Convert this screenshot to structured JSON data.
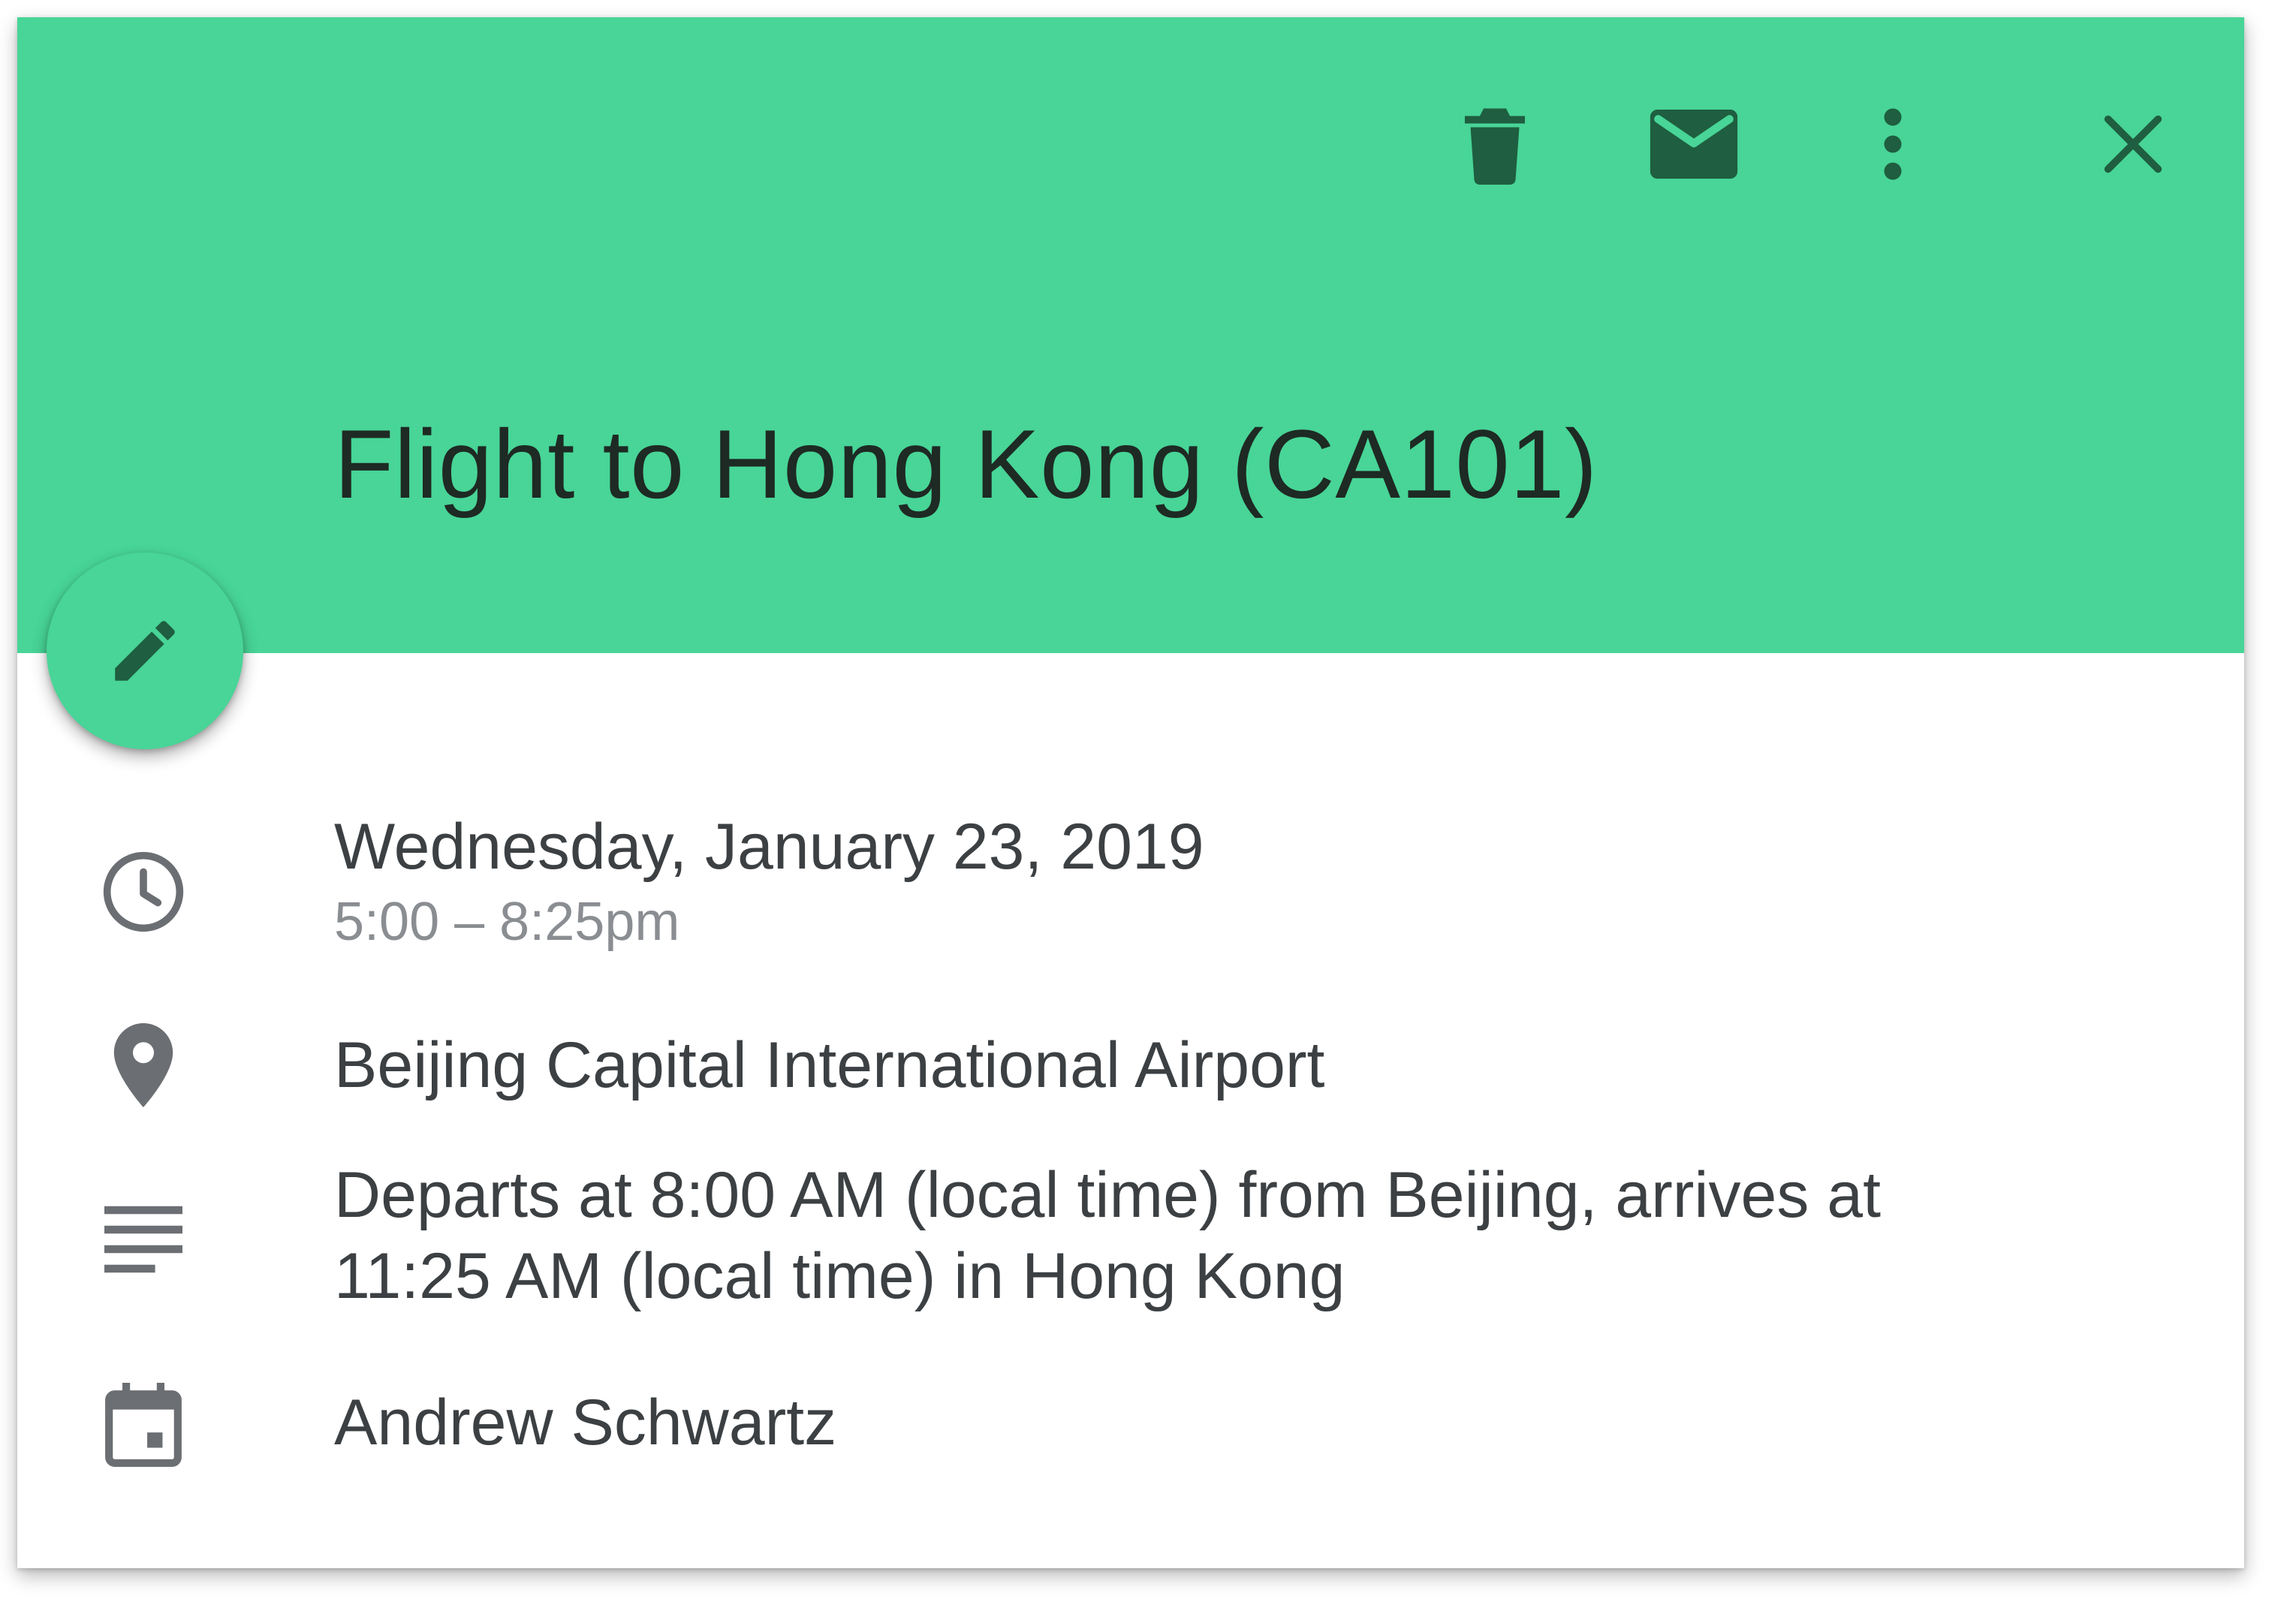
{
  "colors": {
    "header_bg": "#48d597",
    "header_icon": "#1f5e40",
    "fab_bg": "#48d597",
    "fab_icon": "#1f5e40",
    "row_icon": "#6b6e72",
    "text_primary": "#3c4043",
    "text_secondary": "#8a8d91"
  },
  "toolbar": {
    "delete_icon": "trash-icon",
    "email_icon": "envelope-icon",
    "more_icon": "more-vert-icon",
    "close_icon": "close-icon"
  },
  "event": {
    "title": "Flight to Hong Kong (CA101)",
    "date": "Wednesday, January 23, 2019",
    "time": "5:00 – 8:25pm",
    "location": "Beijing Capital International Airport",
    "description_line1": "Departs at 8:00 AM (local time) from Beijing, arrives at",
    "description_line2": "11:25 AM (local time) in Hong Kong",
    "calendar": "Andrew Schwartz"
  },
  "fab": {
    "icon": "pencil-icon"
  },
  "rows": {
    "time_icon": "clock-icon",
    "location_icon": "location-pin-icon",
    "description_icon": "description-icon",
    "calendar_icon": "calendar-icon"
  }
}
